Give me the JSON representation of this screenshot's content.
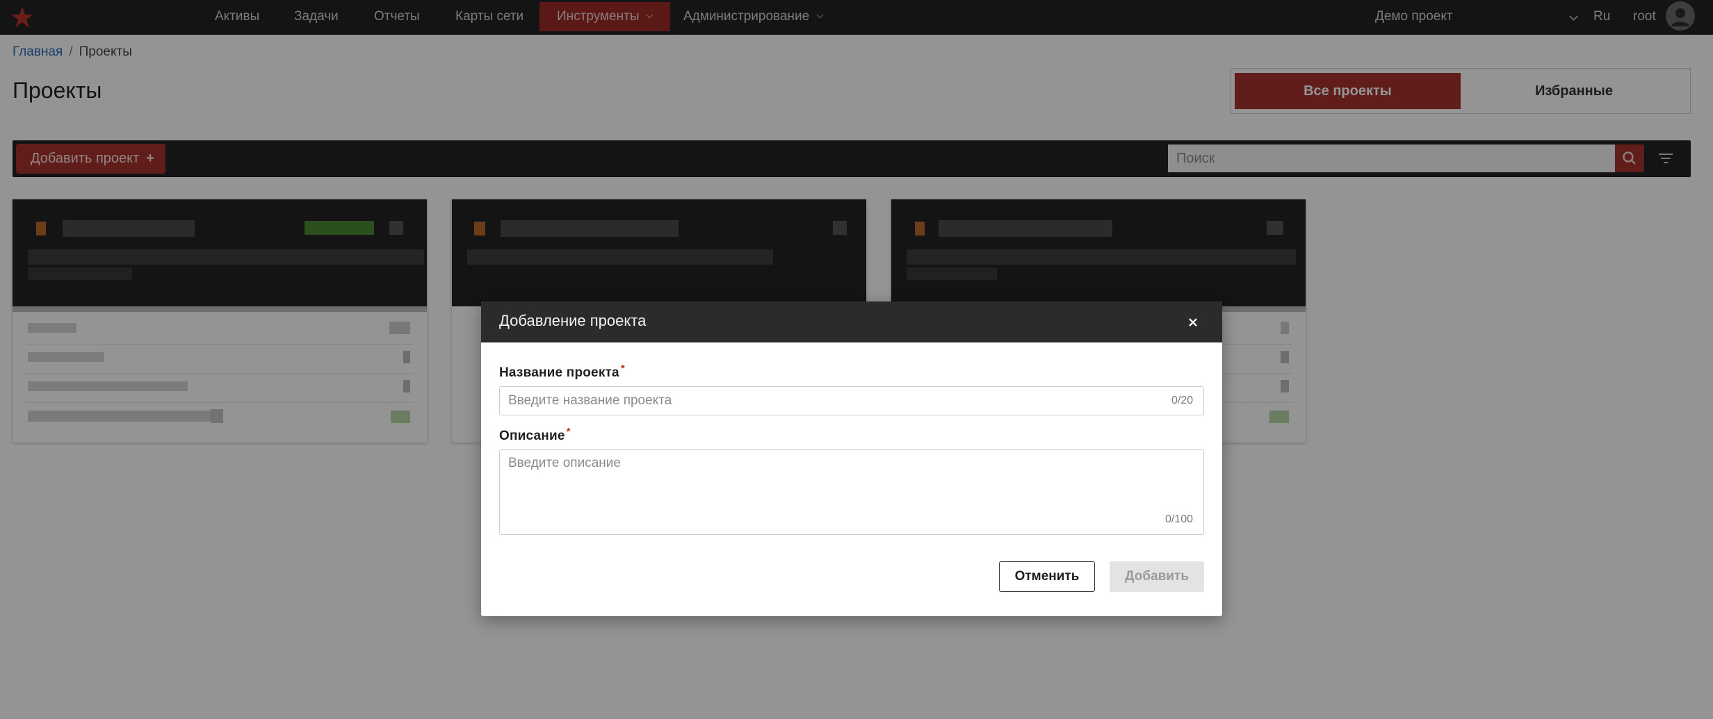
{
  "nav": {
    "items": [
      "Активы",
      "Задачи",
      "Отчеты",
      "Карты сети",
      "Инструменты",
      "Администрирование"
    ],
    "active": "Инструменты",
    "project": "Демо проект",
    "lang": "Ru",
    "user": "root",
    "brand_color": "#9b2b26"
  },
  "breadcrumb": {
    "home": "Главная",
    "separator": "/",
    "current": "Проекты"
  },
  "page": {
    "title": "Проекты"
  },
  "view_toggle": {
    "all": "Все проекты",
    "favorites": "Избранные"
  },
  "toolbar": {
    "add_label": "Добавить проект",
    "add_icon": "plus-icon",
    "search_placeholder": "Поиск",
    "search_icon": "search-icon",
    "filter_icon": "filter-icon"
  },
  "cards_note": "pixelated",
  "modal": {
    "title": "Добавление проекта",
    "close_icon": "close-icon",
    "name_label": "Название проекта",
    "name_placeholder": "Введите название проекта",
    "name_value": "",
    "name_counter": "0/20",
    "desc_label": "Описание",
    "desc_placeholder": "Введите описание",
    "desc_value": "",
    "desc_counter": "0/100",
    "required_mark": "*",
    "cancel": "Отменить",
    "submit": "Добавить"
  }
}
